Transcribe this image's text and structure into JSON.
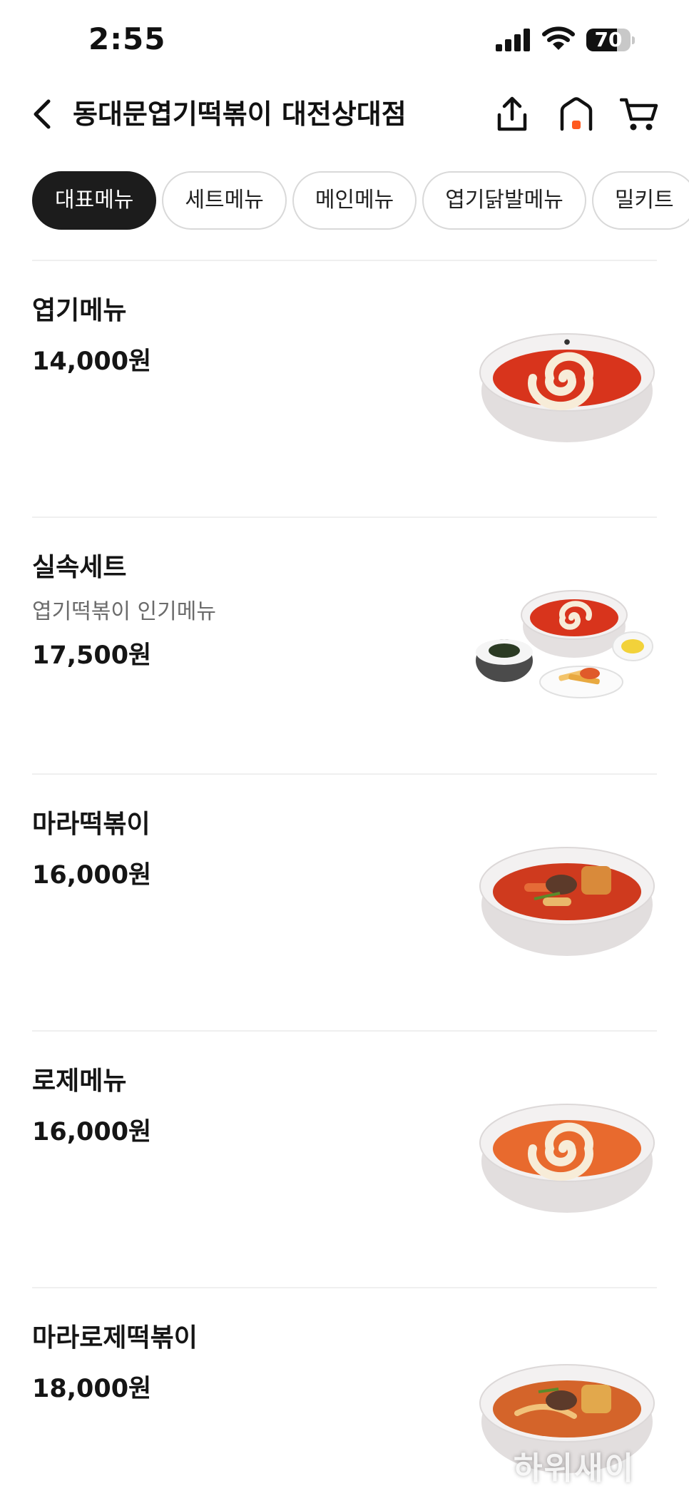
{
  "status_bar": {
    "time": "2:55",
    "battery_level": "70",
    "battery_fraction": 0.7,
    "icons": [
      "cellular-signal-icon",
      "wifi-icon",
      "battery-icon"
    ]
  },
  "header": {
    "title": "동대문엽기떡볶이 대전상대점",
    "icons": [
      "back-arrow-icon",
      "share-icon",
      "home-icon",
      "cart-icon"
    ]
  },
  "tabs": [
    {
      "label": "대표메뉴",
      "active": true
    },
    {
      "label": "세트메뉴",
      "active": false
    },
    {
      "label": "메인메뉴",
      "active": false
    },
    {
      "label": "엽기닭발메뉴",
      "active": false
    },
    {
      "label": "밀키트",
      "active": false
    }
  ],
  "menu_items": [
    {
      "name": "엽기메뉴",
      "description": "",
      "price": "14,000원",
      "image": "tteokbokki-cream-bowl"
    },
    {
      "name": "실속세트",
      "description": "엽기떡볶이 인기메뉴",
      "price": "17,500원",
      "image": "set-meal-platter"
    },
    {
      "name": "마라떡볶이",
      "description": "",
      "price": "16,000원",
      "image": "mala-tteokbokki-bowl"
    },
    {
      "name": "로제메뉴",
      "description": "",
      "price": "16,000원",
      "image": "rose-tteokbokki-bowl"
    },
    {
      "name": "마라로제떡볶이",
      "description": "",
      "price": "18,000원",
      "image": "mala-rose-tteokbokki-bowl"
    }
  ],
  "watermark": "하위새이",
  "colors": {
    "active_tab_bg": "#1c1c1c",
    "tab_border": "#d9d9d9",
    "divider": "#efefef",
    "home_dot": "#ff5a1f",
    "sauce_red": "#d8341c",
    "bowl": "#f1eeee"
  }
}
